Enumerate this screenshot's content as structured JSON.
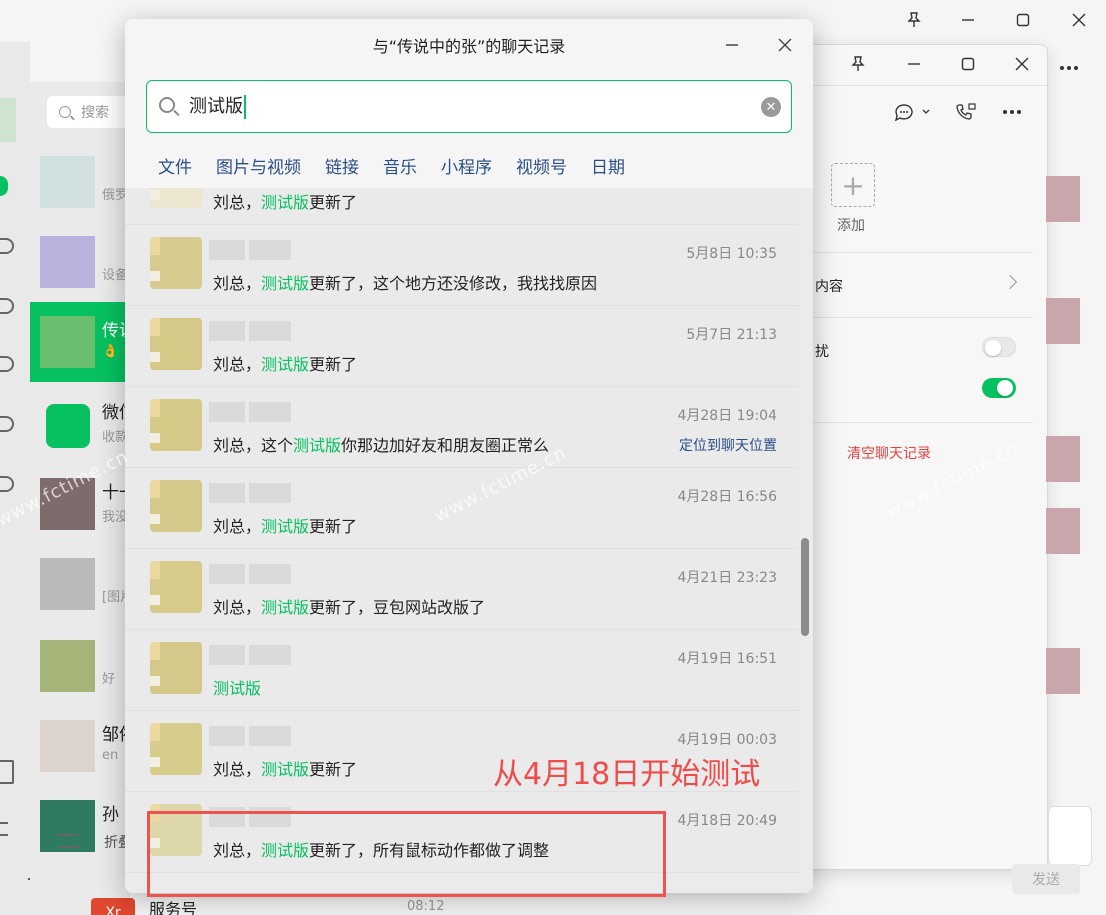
{
  "main_window": {
    "chat_list_search_placeholder": "搜索",
    "chats": [
      {
        "name": "",
        "preview": "俄罗",
        "avatar_color": "#cfe0df"
      },
      {
        "name": "",
        "preview": "设备",
        "avatar_color": "#b8b2dd"
      },
      {
        "name": "传说",
        "preview": "👌",
        "avatar_color": "#69bf6e",
        "active": true
      },
      {
        "name": "微信",
        "preview": "收款",
        "avatar_color": "#07c160"
      },
      {
        "name": "十一",
        "preview": "我没",
        "avatar_color": "#7e6c6c"
      },
      {
        "name": "",
        "preview": "[图片",
        "avatar_color": "#b9b9b9"
      },
      {
        "name": "",
        "preview": "好",
        "avatar_color": "#a5b57a"
      },
      {
        "name": "邹依",
        "preview": "en",
        "avatar_color": "#dcd4cc"
      },
      {
        "name": "孙",
        "preview": "",
        "avatar_color": "#2f7a63"
      }
    ],
    "fold_label": "折叠",
    "service_label": "服务号",
    "service_time": "08:12",
    "service_icon_text": "Xr"
  },
  "info_panel": {
    "add_label": "添加",
    "row_content": "内容",
    "row_dnd": "扰",
    "clear_history": "清空聊天记录",
    "send_label": "发送",
    "dnd_on": false,
    "pin_on": true
  },
  "history_modal": {
    "title": "与“传说中的张”的聊天记录",
    "search_value": "测试版",
    "filters": [
      "文件",
      "图片与视频",
      "链接",
      "音乐",
      "小程序",
      "视频号",
      "日期"
    ],
    "results": [
      {
        "time": "",
        "pre": "刘总，",
        "hl": "测试版",
        "post": "更新了",
        "av": "#ece6d0"
      },
      {
        "time": "5月8日 10:35",
        "pre": "刘总，",
        "hl": "测试版",
        "post": "更新了，这个地方还没修改，我找找原因",
        "av": "#d7cc8f"
      },
      {
        "time": "5月7日 21:13",
        "pre": "刘总，",
        "hl": "测试版",
        "post": "更新了",
        "av": "#d4c987"
      },
      {
        "time": "4月28日 19:04",
        "pre": "刘总，这个",
        "hl": "测试版",
        "post": "你那边加好友和朋友圈正常么",
        "av": "#d5ca88",
        "locate": "定位到聊天位置"
      },
      {
        "time": "4月28日 16:56",
        "pre": "刘总，",
        "hl": "测试版",
        "post": "更新了",
        "av": "#d3c98a"
      },
      {
        "time": "4月21日 23:23",
        "pre": "刘总，",
        "hl": "测试版",
        "post": "更新了，豆包网站改版了",
        "av": "#d6cb8a"
      },
      {
        "time": "4月19日 16:51",
        "pre": "",
        "hl": "测试版",
        "post": "",
        "av": "#d4c98a"
      },
      {
        "time": "4月19日 00:03",
        "pre": "刘总，",
        "hl": "测试版",
        "post": "更新了",
        "av": "#d6cc8c"
      },
      {
        "time": "4月18日 20:49",
        "pre": "刘总，",
        "hl": "测试版",
        "post": "更新了，所有鼠标动作都做了调整",
        "av": "#ddd6a8"
      }
    ]
  },
  "annotation": {
    "text": "从4月18日开始测试",
    "color": "#ef4b4b"
  },
  "watermark": "www.fctime.cn",
  "colors": {
    "accent": "#07c160",
    "link": "#2b4f8a",
    "danger": "#e64340"
  }
}
